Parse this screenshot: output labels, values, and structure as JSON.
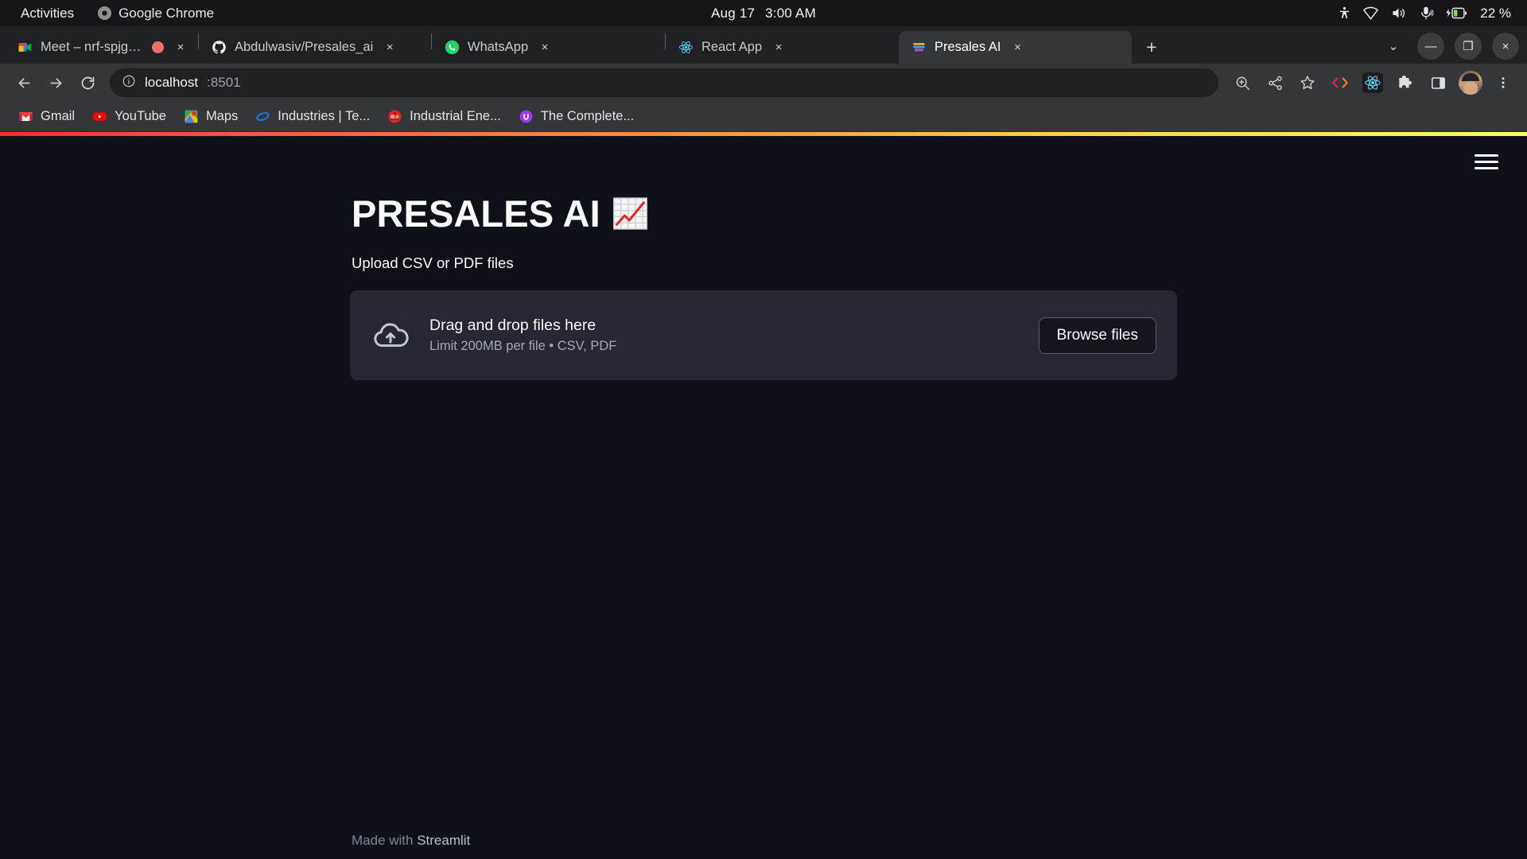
{
  "os_bar": {
    "activities": "Activities",
    "app_name": "Google Chrome",
    "app_icon": "chrome-icon",
    "date": "Aug 17",
    "time": "3:00 AM",
    "tray": {
      "accessibility_icon": "accessibility-icon",
      "network_icon": "wifi-icon",
      "volume_icon": "volume-icon",
      "microphone_icon": "microphone-icon",
      "battery_icon": "battery-charging-icon",
      "battery_percent": "22 %"
    }
  },
  "browser": {
    "tabs": [
      {
        "title": "Meet – nrf-spjg-tfm",
        "icon": "google-meet-icon",
        "recording": true,
        "active": false,
        "close_label": "×"
      },
      {
        "title": "Abdulwasiv/Presales_ai",
        "icon": "github-icon",
        "recording": false,
        "active": false,
        "close_label": "×"
      },
      {
        "title": "WhatsApp",
        "icon": "whatsapp-icon",
        "recording": false,
        "active": false,
        "close_label": "×"
      },
      {
        "title": "React App",
        "icon": "react-icon",
        "recording": false,
        "active": false,
        "close_label": "×"
      },
      {
        "title": "Presales AI",
        "icon": "streamlit-icon",
        "recording": false,
        "active": true,
        "close_label": "×"
      }
    ],
    "new_tab_label": "+",
    "window_controls": {
      "tab_search": "⌄",
      "minimize": "—",
      "maximize": "❐",
      "close": "×"
    },
    "toolbar": {
      "back_icon": "back-arrow-icon",
      "forward_icon": "forward-arrow-icon",
      "reload_icon": "reload-icon",
      "site_info_icon": "info-circle-icon",
      "url_host": "localhost",
      "url_port": ":8501",
      "url_full": "localhost:8501",
      "actions": [
        {
          "name": "zoom-in-icon"
        },
        {
          "name": "share-icon"
        },
        {
          "name": "bookmark-star-icon"
        },
        {
          "name": "code-brackets-extension-icon"
        },
        {
          "name": "react-devtools-icon"
        },
        {
          "name": "extensions-puzzle-icon"
        },
        {
          "name": "side-panel-icon"
        },
        {
          "name": "profile-avatar"
        },
        {
          "name": "chrome-menu-icon"
        }
      ]
    },
    "bookmarks": [
      {
        "label": "Gmail",
        "icon": "gmail-icon"
      },
      {
        "label": "YouTube",
        "icon": "youtube-icon"
      },
      {
        "label": "Maps",
        "icon": "google-maps-icon"
      },
      {
        "label": "Industries | Te...",
        "icon": "industries-icon"
      },
      {
        "label": "Industrial Ene...",
        "icon": "industrial-energy-icon"
      },
      {
        "label": "The Complete...",
        "icon": "udemy-icon"
      }
    ]
  },
  "app": {
    "menu_icon": "hamburger-menu-icon",
    "title": "PRESALES AI",
    "title_emoji": "chart-increasing-emoji",
    "subtitle": "Upload CSV or PDF files",
    "uploader": {
      "icon": "cloud-upload-icon",
      "primary_text": "Drag and drop files here",
      "secondary_text": "Limit 200MB per file • CSV, PDF",
      "button_label": "Browse files"
    },
    "footer": {
      "prefix": "Made with ",
      "link": "Streamlit"
    },
    "colors": {
      "background": "#0e1117",
      "surface": "#262730",
      "text": "#fafafa",
      "accent_gradient_start": "#ff2b2b",
      "accent_gradient_end": "#f6ff6a"
    }
  }
}
